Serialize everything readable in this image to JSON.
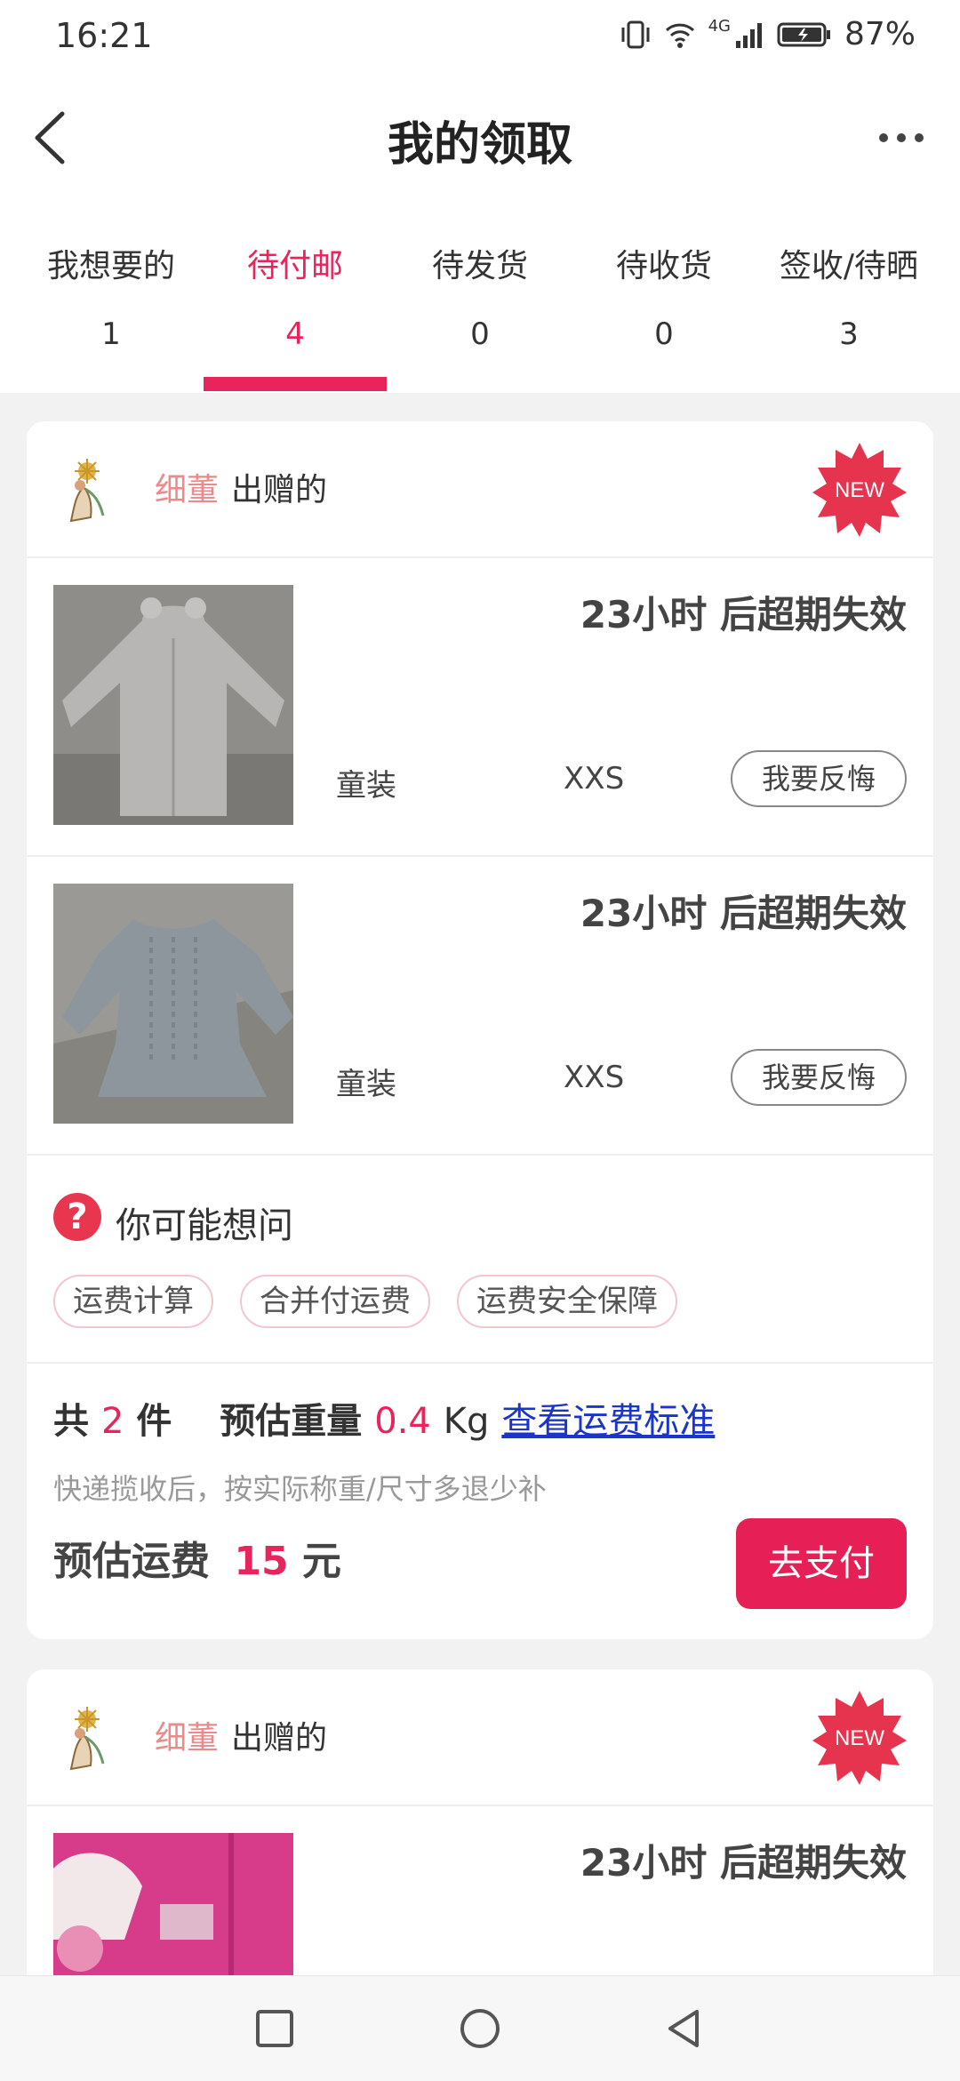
{
  "status_bar": {
    "time": "16:21",
    "battery": "87%",
    "signal": "4G"
  },
  "header": {
    "title": "我的领取"
  },
  "tabs": [
    {
      "label": "我想要的",
      "count": "1"
    },
    {
      "label": "待付邮",
      "count": "4",
      "active": true
    },
    {
      "label": "待发货",
      "count": "0"
    },
    {
      "label": "待收货",
      "count": "0"
    },
    {
      "label": "签收/待晒",
      "count": "3"
    }
  ],
  "cards": [
    {
      "giver_name": "细董",
      "giver_action": "出赠的",
      "badge": "NEW",
      "items": [
        {
          "expire": "23小时 后超期失效",
          "category": "童装",
          "size": "XXS",
          "action": "我要反悔"
        },
        {
          "expire": "23小时 后超期失效",
          "category": "童装",
          "size": "XXS",
          "action": "我要反悔"
        }
      ],
      "faq": {
        "title": "你可能想问",
        "chips": [
          "运费计算",
          "合并付运费",
          "运费安全保障"
        ]
      },
      "summary": {
        "total_prefix": "共",
        "total_count": "2",
        "total_suffix": "件",
        "weight_label": "预估重量",
        "weight_value": "0.4",
        "weight_unit": "Kg",
        "link": "查看运费标准",
        "note": "快递揽收后，按实际称重/尺寸多退少补",
        "fee_label": "预估运费",
        "fee_value": "15",
        "fee_unit": "元",
        "pay_button": "去支付"
      }
    },
    {
      "giver_name": "细董",
      "giver_action": "出赠的",
      "badge": "NEW",
      "items": [
        {
          "expire": "23小时 后超期失效"
        }
      ]
    }
  ],
  "colors": {
    "accent": "#e8245c",
    "link": "#1a35c8",
    "giver": "#ea8a8a"
  }
}
